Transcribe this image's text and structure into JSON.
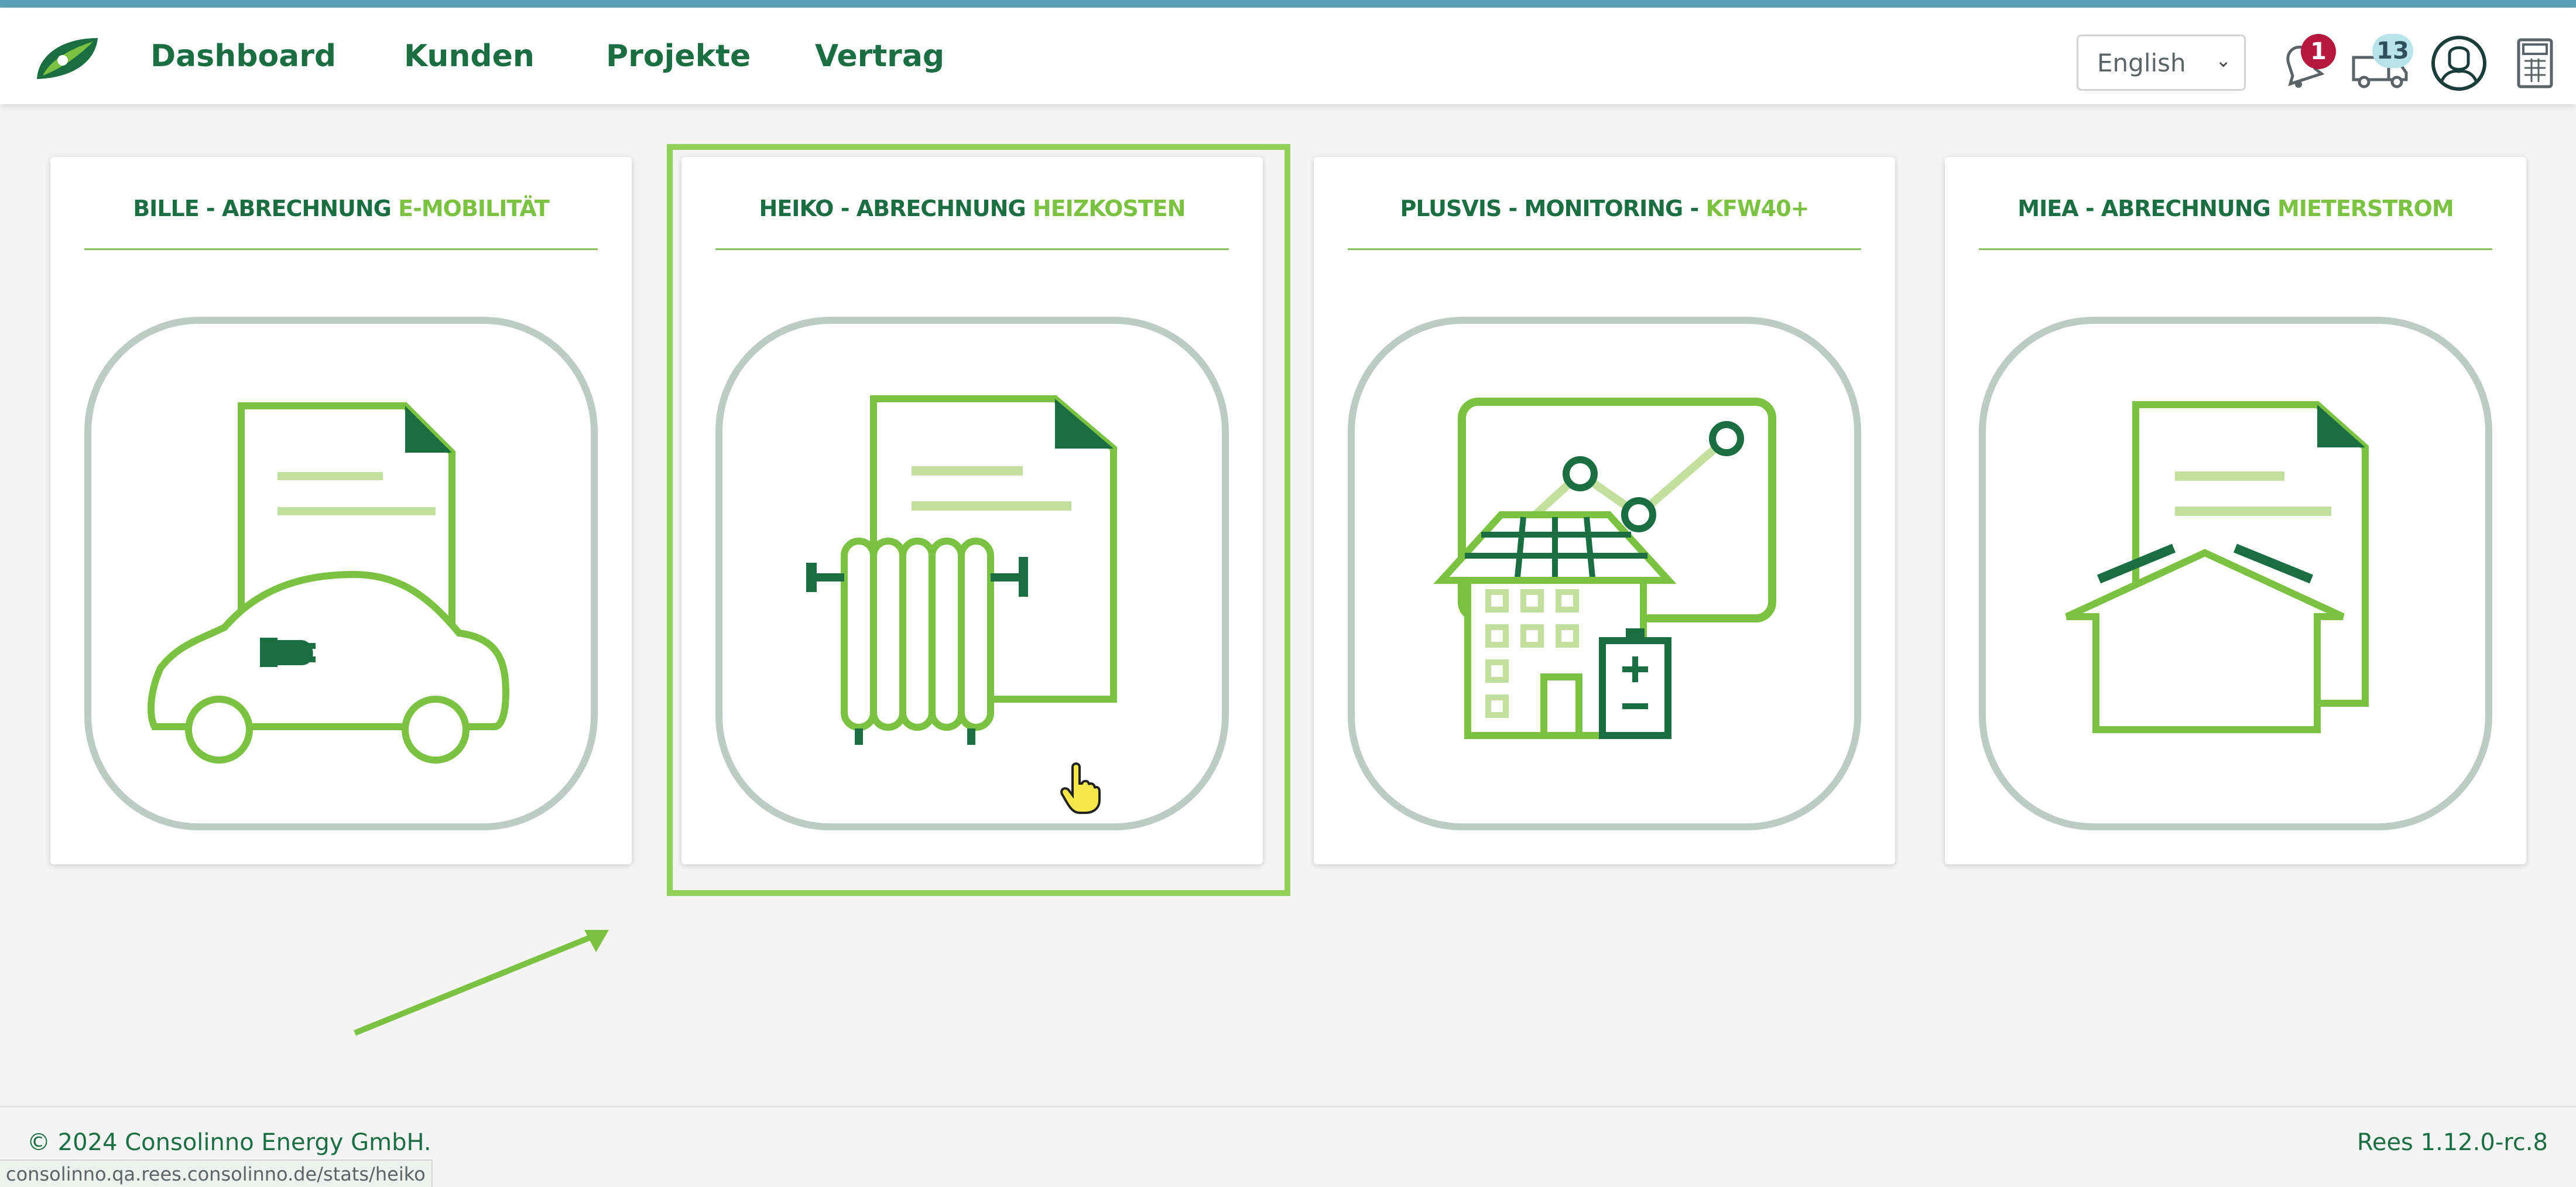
{
  "nav": {
    "items": [
      "Dashboard",
      "Kunden",
      "Projekte",
      "Vertrag"
    ]
  },
  "header": {
    "language": "English",
    "notifications_count": "1",
    "messages_count": "13",
    "icons": [
      "leaf-logo-icon",
      "bell-icon",
      "truck-icon",
      "user-profile-icon",
      "calculator-icon"
    ]
  },
  "cards": [
    {
      "title_dark": "BILLE - ABRECHNUNG",
      "title_light": "E-MOBILITÄT",
      "icon": "electric-car-document-icon"
    },
    {
      "title_dark": "HEIKO - ABRECHNUNG",
      "title_light": "HEIZKOSTEN",
      "icon": "radiator-document-icon"
    },
    {
      "title_dark": "PLUSVIS - MONITORING -",
      "title_light": "KFW40+",
      "icon": "solar-house-monitoring-icon"
    },
    {
      "title_dark": "MIEA - ABRECHNUNG",
      "title_light": "MIETERSTROM",
      "icon": "house-document-icon"
    }
  ],
  "footer": {
    "copyright": "© 2024 Consolinno Energy GmbH.",
    "version": "Rees 1.12.0-rc.8"
  },
  "status_bar": {
    "url": "consolinno.qa.rees.consolinno.de/stats/heiko"
  },
  "colors": {
    "brand_dark": "#1b6e42",
    "brand_light": "#7cc242",
    "accent_focus": "#8ed156",
    "icon_frame": "#bccbc3",
    "badge_red": "#b5173e",
    "badge_teal": "#b7e4ea"
  }
}
